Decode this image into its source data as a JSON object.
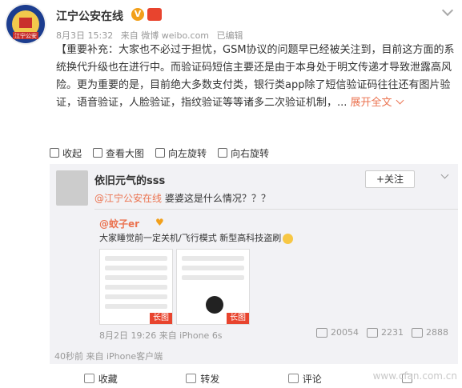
{
  "post": {
    "author": "江宁公安在线",
    "verified_icon": "V",
    "date": "8月3日 15:32",
    "source": "来自 微博 weibo.com",
    "edited": "已编辑",
    "body": "【重要补充：大家也不必过于担忧，GSM协议的问题早已经被关注到，目前这方面的系统换代升级也在进行中。而验证码短信主要还是由于本身处于明文传递才导致泄露高风险。更为重要的是，目前绝大多数支付类，银行类app除了短信验证码往往还有图片验证，语音验证，人脸验证，指纹验证等等诸多二次验证机制，...",
    "expand": "展开全文"
  },
  "image_toolbar": {
    "collapse": "收起",
    "view_large": "查看大图",
    "rotate_left": "向左旋转",
    "rotate_right": "向右旋转"
  },
  "retweet": {
    "author": "依旧元气的sss",
    "follow": "+关注",
    "mention": "@江宁公安在线",
    "comment": " 婆婆这是什么情况？？？",
    "quoted_author": "@蚊子er",
    "quoted_text": "大家睡觉前一定关机/飞行模式 新型高科技盗刷",
    "long_tag": "长图",
    "quoted_meta": "8月2日 19:26 来自 iPhone 6s",
    "stats": {
      "forward": "20054",
      "comment": "2231",
      "like": "2888"
    },
    "time": "40秒前 来自 iPhone客户端"
  },
  "actions": {
    "favorite": "收藏",
    "forward": "转发",
    "comment": "评论",
    "like": ""
  },
  "watermark": "www.cfan.com.cn"
}
